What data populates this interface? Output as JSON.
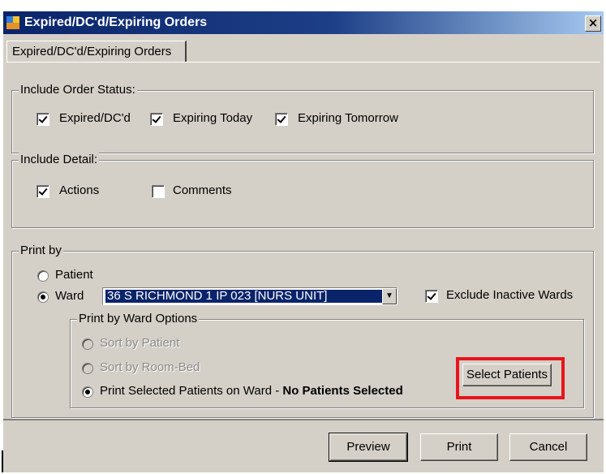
{
  "window": {
    "title": "Expired/DC'd/Expiring Orders",
    "close_glyph": "×"
  },
  "tabs": [
    {
      "label": "Expired/DC'd/Expiring Orders",
      "selected": true
    }
  ],
  "order_status": {
    "legend": "Include Order Status:",
    "options": [
      {
        "label": "Expired/DC'd",
        "checked": true
      },
      {
        "label": "Expiring Today",
        "checked": true
      },
      {
        "label": "Expiring Tomorrow",
        "checked": true
      }
    ]
  },
  "detail": {
    "legend": "Include Detail:",
    "options": [
      {
        "label": "Actions",
        "checked": true
      },
      {
        "label": "Comments",
        "checked": false
      }
    ]
  },
  "print_by": {
    "legend": "Print by",
    "patient_label": "Patient",
    "ward_label": "Ward",
    "selected": "Ward",
    "ward_value": "36 S RICHMOND 1 IP 023 [NURS UNIT]",
    "combo_arrow_glyph": "▼",
    "exclude_inactive_label": "Exclude Inactive Wards",
    "exclude_inactive_checked": true
  },
  "ward_options": {
    "legend": "Print by Ward Options",
    "sort_by_patient": "Sort by Patient",
    "sort_by_room_bed": "Sort by Room-Bed",
    "print_selected": "Print Selected Patients on Ward - ",
    "selection_status": "No Patients Selected",
    "select_patients_label": "Select Patients"
  },
  "buttons": {
    "preview": "Preview",
    "print": "Print",
    "cancel": "Cancel"
  },
  "colors": {
    "highlight": "#e8141b",
    "title_bar": "#0a246a",
    "dialog_bg": "#d4d0c8"
  }
}
